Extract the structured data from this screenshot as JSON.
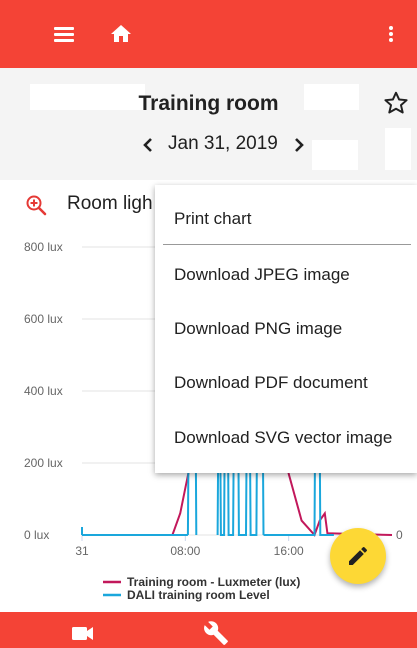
{
  "topbar": {
    "menu_icon": "hamburger-icon",
    "home_icon": "home-icon",
    "more_icon": "more-vertical-icon",
    "color": "#f44336"
  },
  "header": {
    "title": "Training room",
    "favorite_icon": "star-outline-icon",
    "date": "Jan 31, 2019",
    "prev_icon": "chevron-left-icon",
    "next_icon": "chevron-right-icon"
  },
  "chart": {
    "title_visible": "Room ligh",
    "zoom_icon": "zoom-in-icon"
  },
  "chart_data": {
    "type": "line",
    "yticks": [
      "800 lux",
      "600 lux",
      "400 lux",
      "200 lux",
      "0 lux"
    ],
    "y2_tick": "0",
    "xticks": [
      "31",
      "08:00",
      "16:00"
    ],
    "ylim": [
      0,
      800
    ],
    "legend_position": "bottom",
    "series": [
      {
        "name": "Training room - Luxmeter (lux)",
        "color": "#c2185b",
        "x": [
          0,
          1,
          2,
          3,
          4,
          5,
          6,
          7,
          7.2,
          7.6,
          8.0,
          8.4,
          8.6,
          8.8,
          9.5,
          12,
          15,
          15.3,
          15.6,
          16,
          17,
          18,
          18.4,
          18.8,
          19,
          24
        ],
        "y": [
          0,
          0,
          0,
          0,
          0,
          0,
          0,
          0,
          20,
          60,
          130,
          200,
          260,
          310,
          330,
          330,
          330,
          300,
          250,
          170,
          40,
          0,
          40,
          60,
          5,
          0
        ]
      },
      {
        "name": "DALI training room Level",
        "color": "#1aa7dc",
        "segments": [
          [
            [
              0,
              0
            ],
            [
              8.2,
              0
            ]
          ],
          [
            [
              8.2,
              0
            ],
            [
              8.25,
              280
            ],
            [
              8.8,
              280
            ],
            [
              8.85,
              0
            ]
          ],
          [
            [
              10.5,
              0
            ],
            [
              10.55,
              280
            ],
            [
              10.7,
              280
            ],
            [
              10.75,
              0
            ],
            [
              11.0,
              0
            ],
            [
              11.05,
              280
            ],
            [
              11.3,
              280
            ],
            [
              11.35,
              0
            ],
            [
              11.7,
              0
            ],
            [
              11.75,
              280
            ],
            [
              12.1,
              280
            ],
            [
              12.15,
              0
            ],
            [
              12.7,
              0
            ],
            [
              12.75,
              280
            ],
            [
              13.0,
              280
            ],
            [
              13.05,
              0
            ],
            [
              13.5,
              0
            ],
            [
              13.55,
              280
            ],
            [
              14.0,
              280
            ],
            [
              14.05,
              0
            ]
          ],
          [
            [
              14.05,
              0
            ],
            [
              18.0,
              0
            ],
            [
              18.05,
              280
            ],
            [
              18.4,
              280
            ],
            [
              18.45,
              0
            ],
            [
              19.5,
              0
            ]
          ]
        ]
      }
    ]
  },
  "menu": {
    "items": [
      "Print chart",
      "Download JPEG image",
      "Download PNG image",
      "Download PDF document",
      "Download SVG vector image"
    ]
  },
  "fab": {
    "icon": "pencil-icon",
    "color": "#fdd835"
  },
  "bottombar": {
    "camera_icon": "video-camera-icon",
    "wrench_icon": "wrench-icon"
  }
}
